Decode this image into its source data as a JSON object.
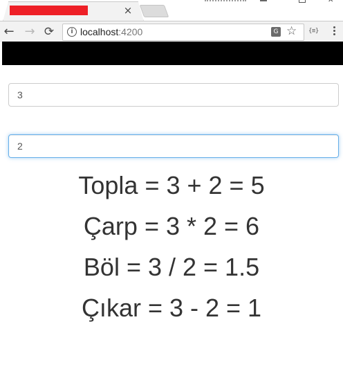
{
  "browser": {
    "tab_close": "×",
    "url_host": "localhost",
    "url_port": ":4200",
    "extension_label": "{≡}"
  },
  "calculator": {
    "first_value": "3",
    "second_value": "2",
    "results": [
      "Topla = 3 + 2 = 5",
      "Çarp = 3 * 2 = 6",
      "Böl = 3 / 2 = 1.5",
      "Çıkar = 3 - 2 = 1"
    ]
  },
  "colors": {
    "header_bar": "#000000",
    "tab_redaction": "#ee2027",
    "focus_border": "#66afe9",
    "result_text": "#333333"
  }
}
